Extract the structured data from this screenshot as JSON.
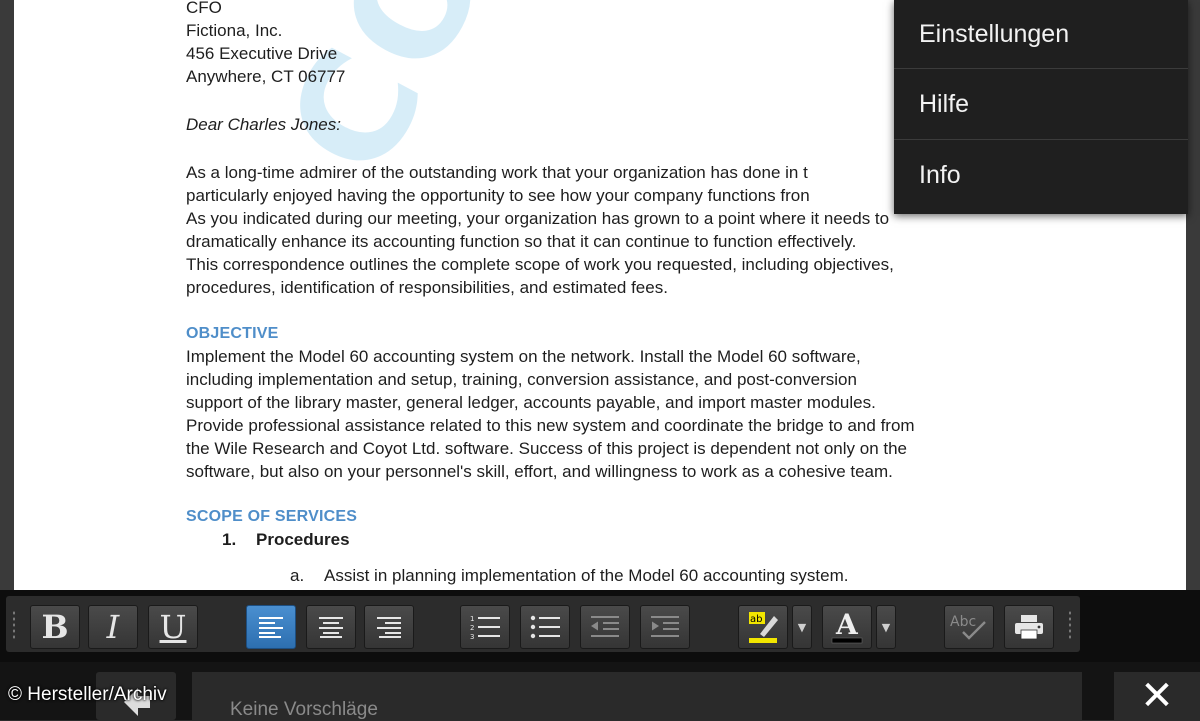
{
  "document": {
    "address_lines": [
      "CFO",
      "Fictiona, Inc.",
      "456 Executive Drive",
      "Anywhere, CT 06777"
    ],
    "salutation": "Dear Charles Jones:",
    "intro_lines": [
      "As a long-time admirer of the outstanding work that your organization has done in t",
      "particularly enjoyed having the opportunity to see how your company functions fron",
      "As you indicated during our meeting, your organization has grown to a point where it needs to",
      "dramatically enhance its accounting function so that it can continue to function effectively.",
      "This correspondence outlines the complete scope of work you requested, including objectives,",
      "procedures, identification of responsibilities, and estimated fees."
    ],
    "objective_heading": "OBJECTIVE",
    "objective_lines": [
      "Implement the Model 60 accounting system on the network. Install the Model 60 software,",
      "including implementation and setup, training, conversion assistance, and post-conversion",
      "support of the library master, general ledger, accounts payable, and import master modules.",
      "Provide professional assistance related to this new system and coordinate the bridge to and from",
      "the Wile Research and Coyot Ltd. software. Success of this project is dependent not only on the",
      "software, but also on your personnel's skill, effort, and willingness to work as a cohesive team."
    ],
    "scope_heading": "SCOPE OF SERVICES",
    "list_item_1_num": "1.",
    "list_item_1": "Procedures",
    "list_item_a_num": "a.",
    "list_item_a": "Assist in planning implementation of the Model 60 accounting system.",
    "watermark": "CONFIDENTIAL"
  },
  "menu": {
    "items": [
      {
        "label": "Einstellungen"
      },
      {
        "label": "Hilfe"
      },
      {
        "label": "Info"
      }
    ]
  },
  "toolbar": {
    "bold": "B",
    "italic": "I",
    "underline": "U",
    "active_alignment": "align-left",
    "highlight_color": "#f2e600",
    "font_color": "#000000"
  },
  "suggestions": {
    "placeholder": "Keine Vorschläge"
  },
  "credit": "© Hersteller/Archiv",
  "colors": {
    "heading": "#4f8ec9",
    "active_button": "#3a80c4",
    "watermark": "#6ebee6"
  }
}
